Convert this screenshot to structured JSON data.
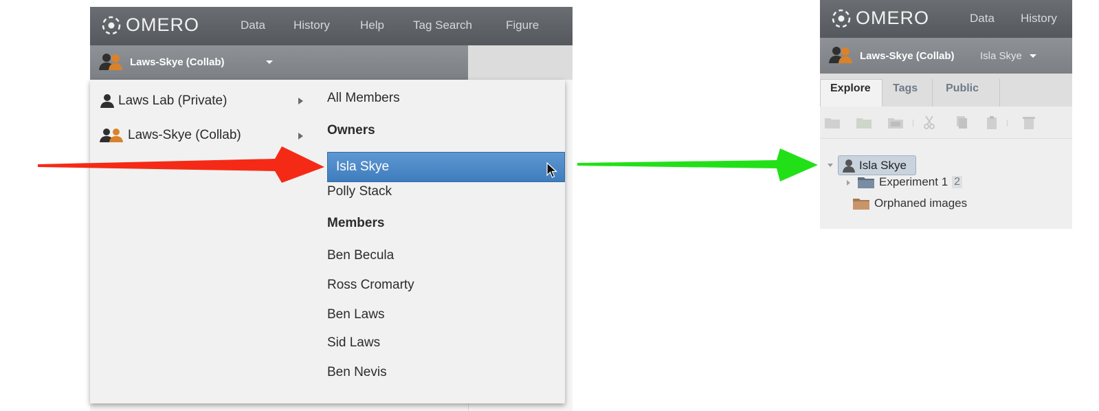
{
  "app": {
    "logo_text": "OMERO",
    "nav": [
      "Data",
      "History",
      "Help",
      "Tag Search",
      "Figure"
    ]
  },
  "left": {
    "current_group": "Laws-Skye (Collab)",
    "groups": [
      {
        "label": "Laws Lab (Private)",
        "icon": "single-user-icon"
      },
      {
        "label": "Laws-Skye (Collab)",
        "icon": "group-users-icon"
      }
    ],
    "members_menu": {
      "all_members": "All Members",
      "owners_header": "Owners",
      "owners": [
        "Isla Skye",
        "Polly Stack"
      ],
      "members_header": "Members",
      "members": [
        "Ben Becula",
        "Ross Cromarty",
        "Ben Laws",
        "Sid Laws",
        "Ben Nevis"
      ],
      "selected": "Isla Skye"
    }
  },
  "arrows": {
    "left_color": "#f52a16",
    "right_color": "#22e018"
  },
  "right": {
    "nav": [
      "Data",
      "History"
    ],
    "current_group": "Laws-Skye (Collab)",
    "current_user": "Isla Skye",
    "tabs": [
      "Explore",
      "Tags",
      "Public"
    ],
    "active_tab": "Explore",
    "tree": {
      "user": "Isla Skye",
      "project": "Experiment 1",
      "project_count": "2",
      "orphaned": "Orphaned images"
    }
  },
  "colors": {
    "selection_blue": "#4a87c7",
    "header_dark": "#5f6367",
    "subbar": "#868a8f",
    "group_icon_orange": "#d9822b"
  }
}
